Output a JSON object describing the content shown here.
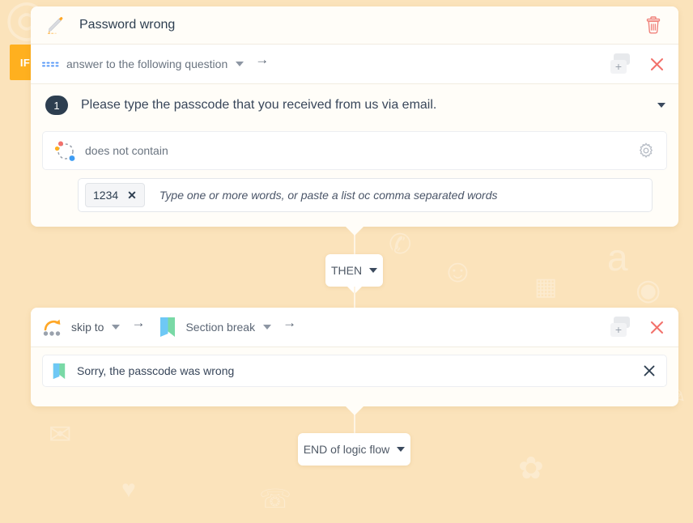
{
  "background": {
    "color": "#fbe3bb",
    "watermarks": [
      "✆",
      "☺",
      "a",
      "▦",
      "✎",
      "◉",
      "☏",
      "✉",
      "♥",
      "✿"
    ]
  },
  "if_badge": {
    "label": "IF",
    "color": "#ffb01f"
  },
  "header": {
    "title": "Password wrong",
    "pencil_icon": "pencil-icon",
    "delete_icon": "trash-icon"
  },
  "condition_row": {
    "icon": "dashed-field-icon",
    "label": "answer to the following question",
    "caret": "chevron-down-icon",
    "arrow": "→",
    "duplicate_icon": "duplicate-icon",
    "duplicate_plus": "+",
    "close_icon": "close-icon"
  },
  "question": {
    "number": "1",
    "text": "Please type the passcode that you received from us via email.",
    "caret": "chevron-down-icon"
  },
  "operator": {
    "icon": "does-not-contain-icon",
    "label": "does not contain",
    "settings_icon": "gear-icon"
  },
  "tag_input": {
    "tags": [
      {
        "label": "1234",
        "remove": "✕"
      }
    ],
    "placeholder": "Type one or more words, or paste a list oc comma separated words"
  },
  "then_connector": {
    "label": "THEN",
    "caret": "chevron-down-icon"
  },
  "action_row": {
    "skip_icon": "skip-to-icon",
    "skip_label": "skip to",
    "skip_caret": "chevron-down-icon",
    "arrow_1": "→",
    "bookmark_icon": "bookmark-icon",
    "target_type": "Section break",
    "target_caret": "chevron-down-icon",
    "arrow_2": "→",
    "duplicate_icon": "duplicate-icon",
    "duplicate_plus": "+",
    "close_icon": "close-icon"
  },
  "action_target": {
    "icon": "bookmark-icon",
    "label": "Sorry, the passcode was wrong",
    "remove": "✕"
  },
  "end_connector": {
    "label": "END of logic flow",
    "caret": "chevron-down-icon"
  },
  "colors": {
    "accent_orange": "#ffb01f",
    "danger": "#f2716b",
    "navy": "#2d3e50",
    "card": "#fffdf8"
  }
}
